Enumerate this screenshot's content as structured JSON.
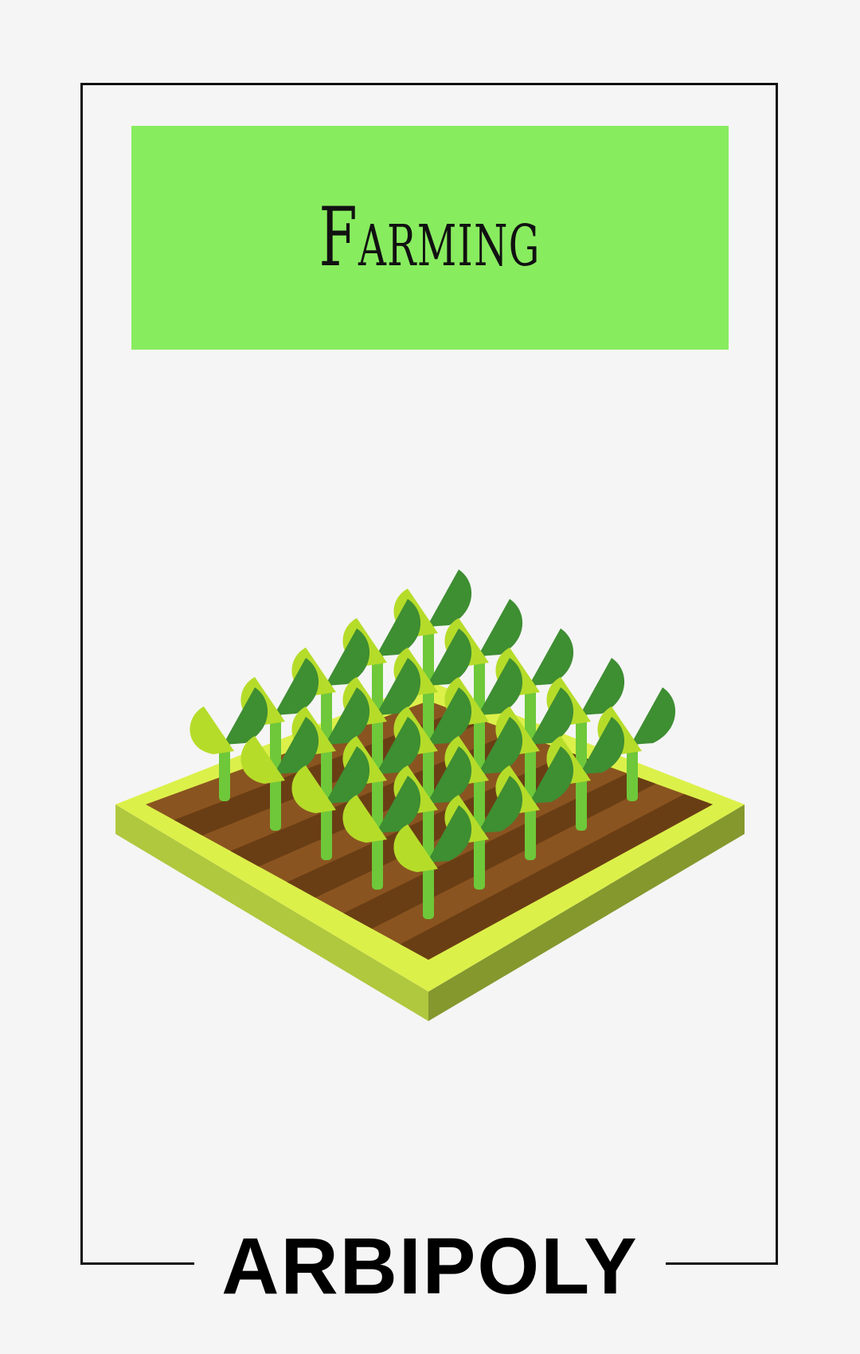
{
  "card": {
    "title": "Farming",
    "brand": "ARBIPOLY"
  },
  "illustration": {
    "icon": "crop-field-icon",
    "grid_rows": 5,
    "grid_cols": 5
  },
  "colors": {
    "banner": "#88ec5f",
    "frame": "#111111",
    "field_rim_top": "#dcf04a",
    "field_rim_left": "#b0c83e",
    "field_rim_right": "#84982e",
    "soil": "#8a5420",
    "soil_furrow": "#6a3e14",
    "stem": "#6ec83a",
    "leaf_light": "#b6dc2a",
    "leaf_dark": "#3e8e32"
  }
}
